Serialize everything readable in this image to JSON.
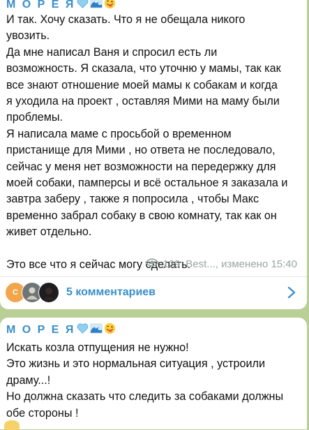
{
  "post1": {
    "author": "М О Р Е Я",
    "text": "И так. Хочу сказать. Что я не обещала никого\nувозить.\nДа мне написал Ваня и спросил есть ли\nвозможность. Я сказала, что уточню у мамы, так как\nвсе знают отношение моей мамы к собакам и когда\nя уходила на проект , оставляя Мими на маму были\nпроблемы.\nЯ написала маме с просьбой о временном\nпристанище для Мими , но ответа не последовало,\nсейчас у меня нет возможности на передержку для\nмоей собаки, памперсы и всё остальное я заказала и\nзавтра заберу , также я попросила , чтобы Макс\nвременно забрал собаку в свою комнату, так как он\nживет отдельно.\n\nЭто все что я сейчас могу сделать.",
    "views": "129",
    "signature": "Best..., изменено 15:40",
    "comments_label": "5 комментариев",
    "avatar_letter": "С"
  },
  "post2": {
    "author": "М О Р Е Я",
    "text": "Искать козла отпущения не нужно!\nЭто жизнь и это нормальная ситуация , устроили\nдраму...!\nНо должна сказать что следить за собаками должны\nобе стороны !"
  },
  "colors": {
    "background": "#b9cf95",
    "accent": "#3a8fc9",
    "meta": "#9aa6a3"
  },
  "icons": [
    "blue-heart-icon",
    "wave-icon",
    "winking-tongue-face-icon",
    "eye-icon",
    "chevron-right-icon"
  ]
}
